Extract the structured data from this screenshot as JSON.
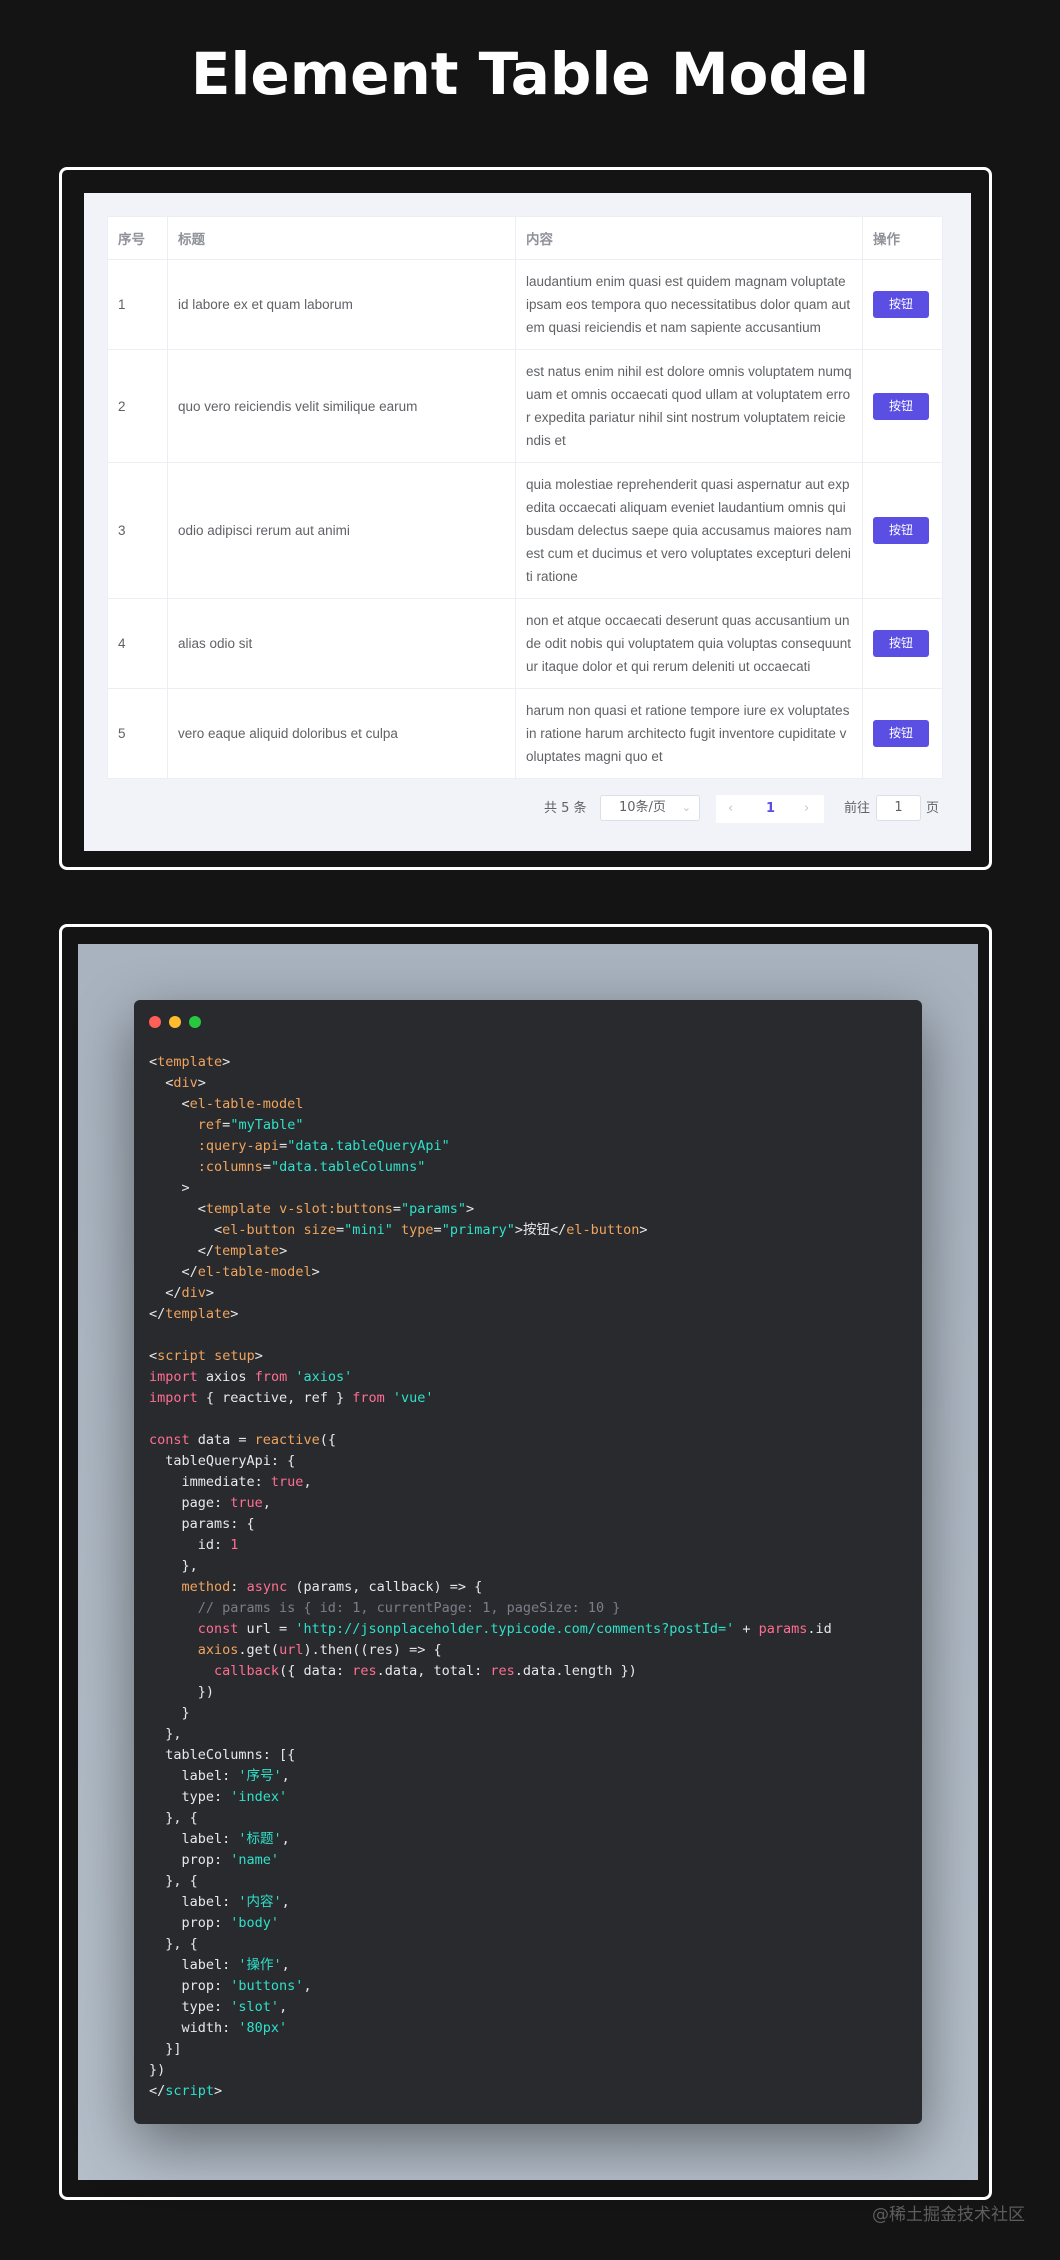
{
  "page": {
    "title": "Element Table Model",
    "watermark": "@稀土掘金技术社区"
  },
  "table": {
    "headers": [
      "序号",
      "标题",
      "内容",
      "操作"
    ],
    "button_label": "按钮",
    "rows": [
      {
        "index": "1",
        "name": "id labore ex et quam laborum",
        "body": "laudantium enim quasi est quidem magnam voluptate ipsam eos tempora quo necessitatibus dolor quam autem quasi reiciendis et nam sapiente accusantium"
      },
      {
        "index": "2",
        "name": "quo vero reiciendis velit similique earum",
        "body": "est natus enim nihil est dolore omnis voluptatem numquam et omnis occaecati quod ullam at voluptatem error expedita pariatur nihil sint nostrum voluptatem reiciendis et"
      },
      {
        "index": "3",
        "name": "odio adipisci rerum aut animi",
        "body": "quia molestiae reprehenderit quasi aspernatur aut expedita occaecati aliquam eveniet laudantium omnis quibusdam delectus saepe quia accusamus maiores nam est cum et ducimus et vero voluptates excepturi deleniti ratione"
      },
      {
        "index": "4",
        "name": "alias odio sit",
        "body": "non et atque occaecati deserunt quas accusantium unde odit nobis qui voluptatem quia voluptas consequuntur itaque dolor et qui rerum deleniti ut occaecati"
      },
      {
        "index": "5",
        "name": "vero eaque aliquid doloribus et culpa",
        "body": "harum non quasi et ratione tempore iure ex voluptates in ratione harum architecto fugit inventore cupiditate voluptates magni quo et"
      }
    ],
    "pagination": {
      "total": "共 5 条",
      "page_size": "10条/页",
      "prev": "‹",
      "current": "1",
      "next": "›",
      "goto_prefix": "前往",
      "goto_value": "1",
      "goto_suffix": "页"
    }
  },
  "code": {
    "window_dots": [
      "#ff5f56",
      "#ffbd2e",
      "#27c93f"
    ],
    "lines": [
      [
        [
          "<",
          "#e8e8e8"
        ],
        [
          "template",
          "#f0a45d"
        ],
        [
          ">",
          "#e8e8e8"
        ]
      ],
      [
        [
          "  <",
          "#e8e8e8"
        ],
        [
          "div",
          "#f0a45d"
        ],
        [
          ">",
          "#e8e8e8"
        ]
      ],
      [
        [
          "    <",
          "#e8e8e8"
        ],
        [
          "el-table-model",
          "#f0a45d"
        ]
      ],
      [
        [
          "      ",
          "#e8e8e8"
        ],
        [
          "ref",
          "#f0a45d"
        ],
        [
          "=",
          "#e8e8e8"
        ],
        [
          "\"myTable\"",
          "#2fe1c9"
        ]
      ],
      [
        [
          "      ",
          "#e8e8e8"
        ],
        [
          ":query-api",
          "#f0a45d"
        ],
        [
          "=",
          "#e8e8e8"
        ],
        [
          "\"data.tableQueryApi\"",
          "#2fe1c9"
        ]
      ],
      [
        [
          "      ",
          "#e8e8e8"
        ],
        [
          ":columns",
          "#f0a45d"
        ],
        [
          "=",
          "#e8e8e8"
        ],
        [
          "\"data.tableColumns\"",
          "#2fe1c9"
        ]
      ],
      [
        [
          "    >",
          "#e8e8e8"
        ]
      ],
      [
        [
          "      <",
          "#e8e8e8"
        ],
        [
          "template",
          "#f0a45d"
        ],
        [
          " ",
          "#e8e8e8"
        ],
        [
          "v-slot:buttons",
          "#f0a45d"
        ],
        [
          "=",
          "#e8e8e8"
        ],
        [
          "\"params\"",
          "#2fe1c9"
        ],
        [
          ">",
          "#e8e8e8"
        ]
      ],
      [
        [
          "        <",
          "#e8e8e8"
        ],
        [
          "el-button",
          "#f0a45d"
        ],
        [
          " ",
          "#e8e8e8"
        ],
        [
          "size",
          "#f0a45d"
        ],
        [
          "=",
          "#e8e8e8"
        ],
        [
          "\"mini\"",
          "#2fe1c9"
        ],
        [
          " ",
          "#e8e8e8"
        ],
        [
          "type",
          "#f0a45d"
        ],
        [
          "=",
          "#e8e8e8"
        ],
        [
          "\"primary\"",
          "#2fe1c9"
        ],
        [
          ">按钮</",
          "#e8e8e8"
        ],
        [
          "el-button",
          "#f0a45d"
        ],
        [
          ">",
          "#e8e8e8"
        ]
      ],
      [
        [
          "      </",
          "#e8e8e8"
        ],
        [
          "template",
          "#f0a45d"
        ],
        [
          ">",
          "#e8e8e8"
        ]
      ],
      [
        [
          "    </",
          "#e8e8e8"
        ],
        [
          "el-table-model",
          "#f0a45d"
        ],
        [
          ">",
          "#e8e8e8"
        ]
      ],
      [
        [
          "  </",
          "#e8e8e8"
        ],
        [
          "div",
          "#f0a45d"
        ],
        [
          ">",
          "#e8e8e8"
        ]
      ],
      [
        [
          "</",
          "#e8e8e8"
        ],
        [
          "template",
          "#f0a45d"
        ],
        [
          ">",
          "#e8e8e8"
        ]
      ],
      [
        [
          "",
          "#e8e8e8"
        ]
      ],
      [
        [
          "<",
          "#e8e8e8"
        ],
        [
          "script",
          "#f0a45d"
        ],
        [
          " ",
          "#e8e8e8"
        ],
        [
          "setup",
          "#f0a45d"
        ],
        [
          ">",
          "#e8e8e8"
        ]
      ],
      [
        [
          "import",
          "#ff6e91"
        ],
        [
          " axios ",
          "#e8e8e8"
        ],
        [
          "from",
          "#ff6e91"
        ],
        [
          " ",
          "#e8e8e8"
        ],
        [
          "'axios'",
          "#2fe1c9"
        ]
      ],
      [
        [
          "import",
          "#ff6e91"
        ],
        [
          " { reactive, ref } ",
          "#e8e8e8"
        ],
        [
          "from",
          "#ff6e91"
        ],
        [
          " ",
          "#e8e8e8"
        ],
        [
          "'vue'",
          "#2fe1c9"
        ]
      ],
      [
        [
          "",
          "#e8e8e8"
        ]
      ],
      [
        [
          "const",
          "#ff6e91"
        ],
        [
          " data = ",
          "#e8e8e8"
        ],
        [
          "reactive",
          "#f0a45d"
        ],
        [
          "({",
          "#e8e8e8"
        ]
      ],
      [
        [
          "  tableQueryApi: {",
          "#e8e8e8"
        ]
      ],
      [
        [
          "    immediate: ",
          "#e8e8e8"
        ],
        [
          "true",
          "#ff6e91"
        ],
        [
          ",",
          "#e8e8e8"
        ]
      ],
      [
        [
          "    page: ",
          "#e8e8e8"
        ],
        [
          "true",
          "#ff6e91"
        ],
        [
          ",",
          "#e8e8e8"
        ]
      ],
      [
        [
          "    params: {",
          "#e8e8e8"
        ]
      ],
      [
        [
          "      id: ",
          "#e8e8e8"
        ],
        [
          "1",
          "#ff6e91"
        ]
      ],
      [
        [
          "    },",
          "#e8e8e8"
        ]
      ],
      [
        [
          "    ",
          "#e8e8e8"
        ],
        [
          "method",
          "#f0a45d"
        ],
        [
          ": ",
          "#e8e8e8"
        ],
        [
          "async",
          "#ff6e91"
        ],
        [
          " (params, callback) => {",
          "#e8e8e8"
        ]
      ],
      [
        [
          "      // params is { id: 1, currentPage: 1, pageSize: 10 }",
          "#7a7f87"
        ]
      ],
      [
        [
          "      ",
          "#e8e8e8"
        ],
        [
          "const",
          "#ff6e91"
        ],
        [
          " url = ",
          "#e8e8e8"
        ],
        [
          "'http://jsonplaceholder.typicode.com/comments?postId='",
          "#2fe1c9"
        ],
        [
          " + ",
          "#e8e8e8"
        ],
        [
          "params",
          "#ff6e91"
        ],
        [
          ".id",
          "#e8e8e8"
        ]
      ],
      [
        [
          "      ",
          "#e8e8e8"
        ],
        [
          "axios",
          "#f0a45d"
        ],
        [
          ".get(",
          "#e8e8e8"
        ],
        [
          "url",
          "#ff6e91"
        ],
        [
          ").then((res) => {",
          "#e8e8e8"
        ]
      ],
      [
        [
          "        ",
          "#e8e8e8"
        ],
        [
          "callback",
          "#ff6e91"
        ],
        [
          "({ data: ",
          "#e8e8e8"
        ],
        [
          "res",
          "#ff6e91"
        ],
        [
          ".data, total: ",
          "#e8e8e8"
        ],
        [
          "res",
          "#ff6e91"
        ],
        [
          ".data.length })",
          "#e8e8e8"
        ]
      ],
      [
        [
          "      })",
          "#e8e8e8"
        ]
      ],
      [
        [
          "    }",
          "#e8e8e8"
        ]
      ],
      [
        [
          "  },",
          "#e8e8e8"
        ]
      ],
      [
        [
          "  tableColumns: [{",
          "#e8e8e8"
        ]
      ],
      [
        [
          "    label: ",
          "#e8e8e8"
        ],
        [
          "'序号'",
          "#2fe1c9"
        ],
        [
          ",",
          "#e8e8e8"
        ]
      ],
      [
        [
          "    type: ",
          "#e8e8e8"
        ],
        [
          "'index'",
          "#2fe1c9"
        ]
      ],
      [
        [
          "  }, {",
          "#e8e8e8"
        ]
      ],
      [
        [
          "    label: ",
          "#e8e8e8"
        ],
        [
          "'标题'",
          "#2fe1c9"
        ],
        [
          ",",
          "#e8e8e8"
        ]
      ],
      [
        [
          "    prop: ",
          "#e8e8e8"
        ],
        [
          "'name'",
          "#2fe1c9"
        ]
      ],
      [
        [
          "  }, {",
          "#e8e8e8"
        ]
      ],
      [
        [
          "    label: ",
          "#e8e8e8"
        ],
        [
          "'内容'",
          "#2fe1c9"
        ],
        [
          ",",
          "#e8e8e8"
        ]
      ],
      [
        [
          "    prop: ",
          "#e8e8e8"
        ],
        [
          "'body'",
          "#2fe1c9"
        ]
      ],
      [
        [
          "  }, {",
          "#e8e8e8"
        ]
      ],
      [
        [
          "    label: ",
          "#e8e8e8"
        ],
        [
          "'操作'",
          "#2fe1c9"
        ],
        [
          ",",
          "#e8e8e8"
        ]
      ],
      [
        [
          "    prop: ",
          "#e8e8e8"
        ],
        [
          "'buttons'",
          "#2fe1c9"
        ],
        [
          ",",
          "#e8e8e8"
        ]
      ],
      [
        [
          "    type: ",
          "#e8e8e8"
        ],
        [
          "'slot'",
          "#2fe1c9"
        ],
        [
          ",",
          "#e8e8e8"
        ]
      ],
      [
        [
          "    width: ",
          "#e8e8e8"
        ],
        [
          "'80px'",
          "#2fe1c9"
        ]
      ],
      [
        [
          "  }]",
          "#e8e8e8"
        ]
      ],
      [
        [
          "})",
          "#e8e8e8"
        ]
      ],
      [
        [
          "</",
          "#e8e8e8"
        ],
        [
          "script",
          "#2fe1c9"
        ],
        [
          ">",
          "#e8e8e8"
        ]
      ]
    ]
  }
}
